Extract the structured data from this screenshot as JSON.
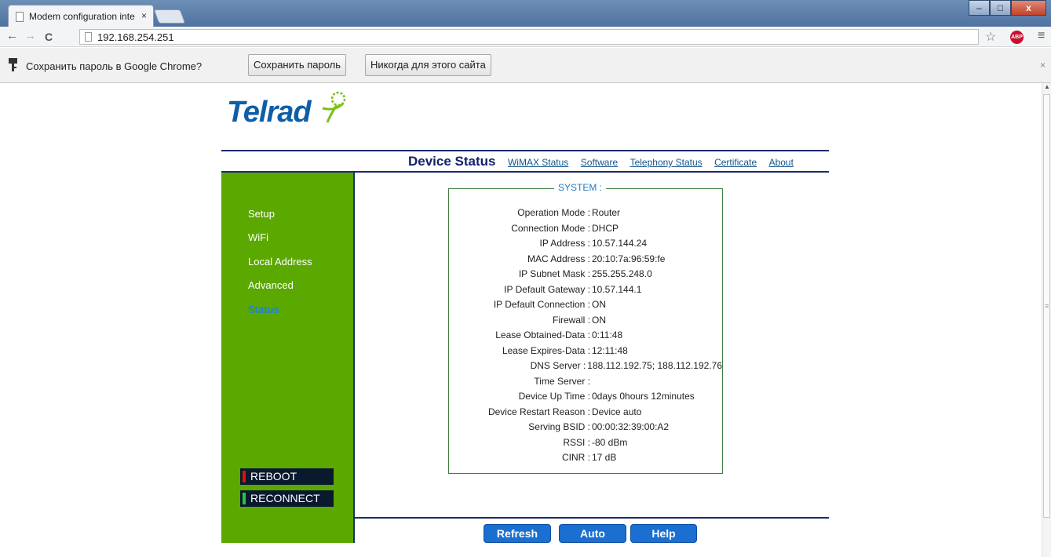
{
  "browser": {
    "tab_title": "Modem configuration inte",
    "tab_close": "×",
    "url": "192.168.254.251",
    "win_min": "–",
    "win_max": "□",
    "win_close": "x",
    "back": "←",
    "forward": "→",
    "reload": "C",
    "star": "☆",
    "abp": "ABP",
    "menu": "≡"
  },
  "infobar": {
    "message": "Сохранить пароль в Google Chrome?",
    "save_label": "Сохранить пароль",
    "never_label": "Никогда для этого сайта",
    "close": "×"
  },
  "logo": {
    "text": "Telrad"
  },
  "nav": {
    "current": "Device Status",
    "links": [
      "WiMAX Status",
      "Software",
      "Telephony Status",
      "Certificate",
      "About"
    ]
  },
  "sidebar": {
    "items": [
      "Setup",
      "WiFi",
      "Local Address",
      "Advanced",
      "Status"
    ],
    "reboot": "REBOOT",
    "reconnect": "RECONNECT"
  },
  "system": {
    "legend": "SYSTEM :",
    "rows": [
      {
        "k": "Operation Mode :",
        "v": "Router"
      },
      {
        "k": "Connection Mode :",
        "v": "DHCP"
      },
      {
        "k": "IP Address :",
        "v": "10.57.144.24"
      },
      {
        "k": "MAC Address :",
        "v": "20:10:7a:96:59:fe"
      },
      {
        "k": "IP Subnet Mask :",
        "v": "255.255.248.0"
      },
      {
        "k": "IP Default Gateway :",
        "v": "10.57.144.1"
      },
      {
        "k": "IP Default Connection :",
        "v": "ON"
      },
      {
        "k": "Firewall :",
        "v": "ON"
      },
      {
        "k": "Lease Obtained-Data :",
        "v": "0:11:48"
      },
      {
        "k": "Lease Expires-Data :",
        "v": "12:11:48"
      },
      {
        "k": "DNS Server :",
        "v": "188.112.192.75; 188.112.192.76"
      },
      {
        "k": "Time Server :",
        "v": ""
      },
      {
        "k": "Device Up Time :",
        "v": "0days 0hours 12minutes"
      },
      {
        "k": "Device Restart Reason :",
        "v": "Device auto"
      },
      {
        "k": "Serving BSID :",
        "v": "00:00:32:39:00:A2"
      },
      {
        "k": "RSSI :",
        "v": "-80 dBm"
      },
      {
        "k": "CINR :",
        "v": "17 dB"
      }
    ]
  },
  "buttons": {
    "refresh": "Refresh",
    "auto": "Auto",
    "help": "Help"
  },
  "colors": {
    "sidebar": "#5aa800",
    "navy": "#1b2b6b",
    "button_blue": "#1a6fd0",
    "reboot_bar": "#e01010",
    "reconnect_bar": "#30c040"
  }
}
